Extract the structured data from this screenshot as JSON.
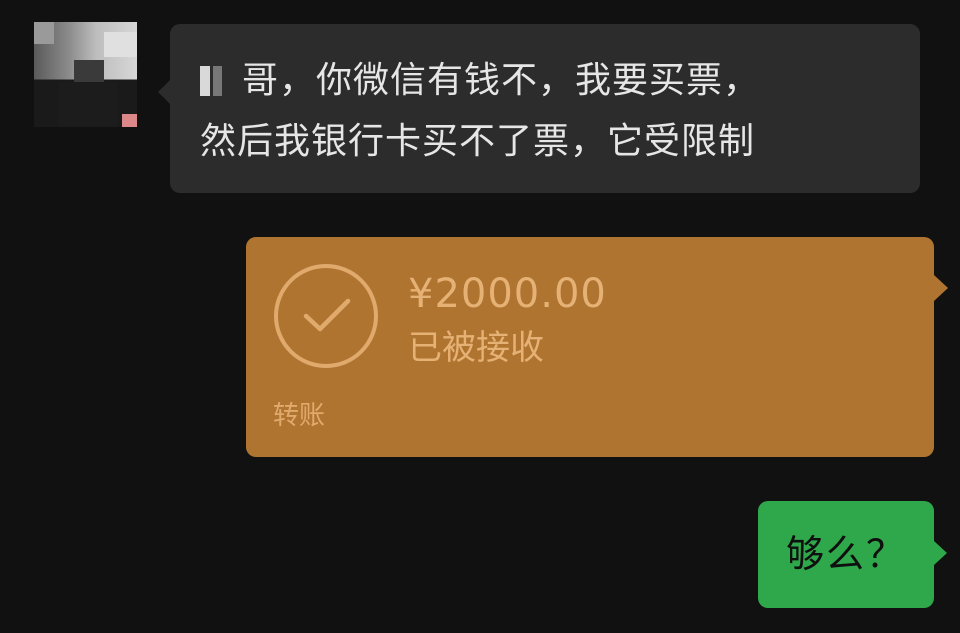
{
  "messages": {
    "incoming": {
      "line1": "哥，你微信有钱不，我要买票，",
      "line2": "然后我银行卡买不了票，它受限制"
    },
    "transfer": {
      "amount": "¥2000.00",
      "status": "已被接收",
      "label": "转账",
      "icon": "check-circle-icon",
      "color": "#b07431"
    },
    "outgoing": {
      "text": "够么？",
      "color": "#2ea84b"
    }
  },
  "theme": {
    "background": "#111111",
    "incoming_bubble": "#2c2c2c"
  }
}
